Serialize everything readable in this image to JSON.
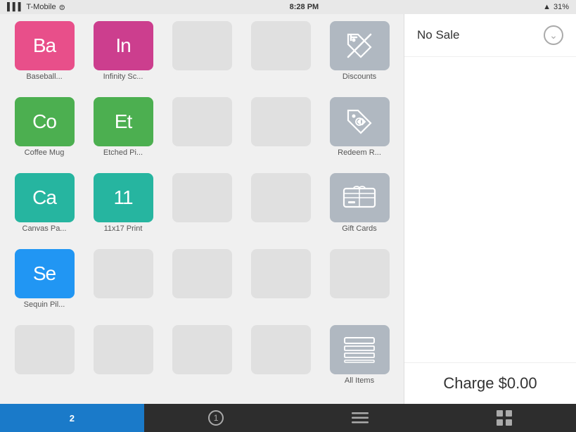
{
  "statusBar": {
    "carrier": "T-Mobile",
    "time": "8:28 PM",
    "battery": "31%",
    "wifi": true
  },
  "products": [
    {
      "id": "baseball",
      "abbr": "Ba",
      "label": "Baseball...",
      "color": "pink",
      "empty": false
    },
    {
      "id": "infinity",
      "abbr": "In",
      "label": "Infinity Sc...",
      "color": "magenta",
      "empty": false
    },
    {
      "id": "empty1",
      "abbr": "",
      "label": "",
      "color": "empty",
      "empty": true
    },
    {
      "id": "empty2",
      "abbr": "",
      "label": "",
      "color": "empty",
      "empty": true
    },
    {
      "id": "discounts",
      "abbr": "disc",
      "label": "Discounts",
      "color": "action",
      "empty": false
    },
    {
      "id": "coffee",
      "abbr": "Co",
      "label": "Coffee Mug",
      "color": "green",
      "empty": false
    },
    {
      "id": "etched",
      "abbr": "Et",
      "label": "Etched Pi...",
      "color": "green",
      "empty": false
    },
    {
      "id": "empty3",
      "abbr": "",
      "label": "",
      "color": "empty",
      "empty": true
    },
    {
      "id": "empty4",
      "abbr": "",
      "label": "",
      "color": "empty",
      "empty": true
    },
    {
      "id": "redeemr",
      "abbr": "rr",
      "label": "Redeem R...",
      "color": "action",
      "empty": false
    },
    {
      "id": "canvas",
      "abbr": "Ca",
      "label": "Canvas Pa...",
      "color": "teal",
      "empty": false
    },
    {
      "id": "print",
      "abbr": "11",
      "label": "11x17 Print",
      "color": "teal",
      "empty": false
    },
    {
      "id": "empty5",
      "abbr": "",
      "label": "",
      "color": "empty",
      "empty": true
    },
    {
      "id": "empty6",
      "abbr": "",
      "label": "",
      "color": "empty",
      "empty": true
    },
    {
      "id": "giftcards",
      "abbr": "gc",
      "label": "Gift Cards",
      "color": "action",
      "empty": false
    },
    {
      "id": "sequin",
      "abbr": "Se",
      "label": "Sequin Pil...",
      "color": "blue",
      "empty": false
    },
    {
      "id": "empty7",
      "abbr": "",
      "label": "",
      "color": "empty",
      "empty": true
    },
    {
      "id": "empty8",
      "abbr": "",
      "label": "",
      "color": "empty",
      "empty": true
    },
    {
      "id": "empty9",
      "abbr": "",
      "label": "",
      "color": "empty",
      "empty": true
    },
    {
      "id": "empty10",
      "abbr": "",
      "label": "",
      "color": "empty",
      "empty": true
    },
    {
      "id": "empty11",
      "abbr": "",
      "label": "",
      "color": "empty",
      "empty": true
    },
    {
      "id": "empty12",
      "abbr": "",
      "label": "",
      "color": "empty",
      "empty": true
    },
    {
      "id": "empty13",
      "abbr": "",
      "label": "",
      "color": "empty",
      "empty": true
    },
    {
      "id": "empty14",
      "abbr": "",
      "label": "",
      "color": "empty",
      "empty": true
    },
    {
      "id": "allitems",
      "abbr": "ai",
      "label": "All Items",
      "color": "action",
      "empty": false
    }
  ],
  "rightPanel": {
    "noSaleLabel": "No Sale",
    "chargeLabel": "Charge $0.00"
  },
  "bottomBar": {
    "tabs": [
      {
        "id": "tab-num",
        "label": "2",
        "type": "badge",
        "active": true
      },
      {
        "id": "tab-circle",
        "label": "1",
        "type": "circle",
        "active": false
      },
      {
        "id": "tab-list",
        "label": "",
        "type": "list-icon",
        "active": false
      },
      {
        "id": "tab-grid",
        "label": "",
        "type": "grid-icon",
        "active": false
      }
    ]
  }
}
